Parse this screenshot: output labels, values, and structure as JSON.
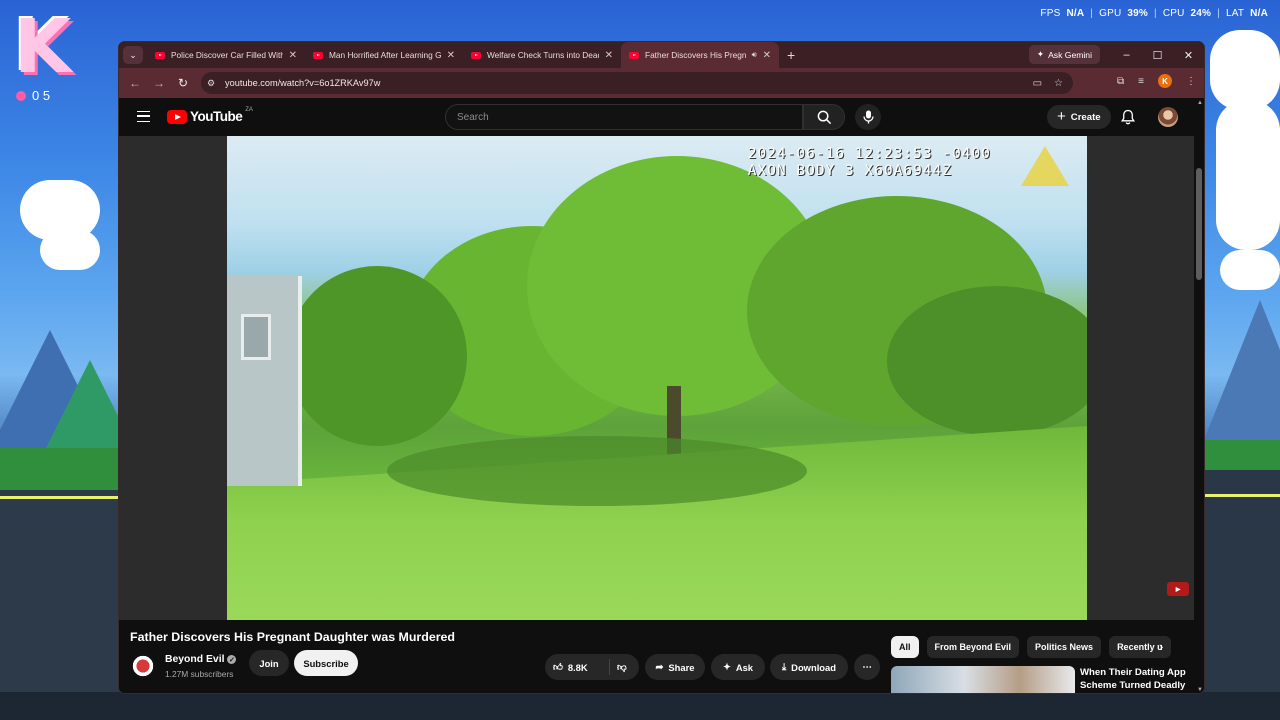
{
  "overlay": {
    "fps_label": "FPS",
    "fps_value": "N/A",
    "gpu_label": "GPU",
    "gpu_value": "39%",
    "cpu_label": "CPU",
    "cpu_value": "24%",
    "lat_label": "LAT",
    "lat_value": "N/A",
    "separator": "|"
  },
  "desktop": {
    "logo_letter": "K",
    "badge_text": "0 5"
  },
  "browser": {
    "tabs": [
      {
        "title": "Police Discover Car Filled With"
      },
      {
        "title": "Man Horrified After Learning Gi"
      },
      {
        "title": "Welfare Check Turns into Deadl"
      },
      {
        "title": "Father Discovers His Pregnant",
        "active": true
      }
    ],
    "new_tab_glyph": "+",
    "gemini_label": "Ask Gemini",
    "url": "youtube.com/watch?v=6o1ZRKAv97w",
    "profile_initial": "K"
  },
  "youtube": {
    "logo_text": "YouTube",
    "country_code": "ZA",
    "search_placeholder": "Search",
    "create_label": "Create",
    "video": {
      "timestamp": "2024-06-16 12:23:53 -0400",
      "camera": "AXON BODY 3 X60A6944Z",
      "title": "Father Discovers His Pregnant Daughter was Murdered"
    },
    "channel": {
      "name": "Beyond Evil",
      "subscribers": "1.27M subscribers"
    },
    "actions": {
      "join": "Join",
      "subscribe": "Subscribe",
      "likes": "8.8K",
      "share": "Share",
      "ask": "Ask",
      "download": "Download"
    },
    "chips": [
      "All",
      "From Beyond Evil",
      "Politics News",
      "Recently u"
    ],
    "recommendation": {
      "title": "When Their Dating App Scheme Turned Deadly"
    }
  },
  "colors": {
    "tab_bar": "#3a1f24",
    "tab_active": "#5b2b34",
    "youtube_red": "#ff0000",
    "yt_background": "#0f0f0f"
  }
}
